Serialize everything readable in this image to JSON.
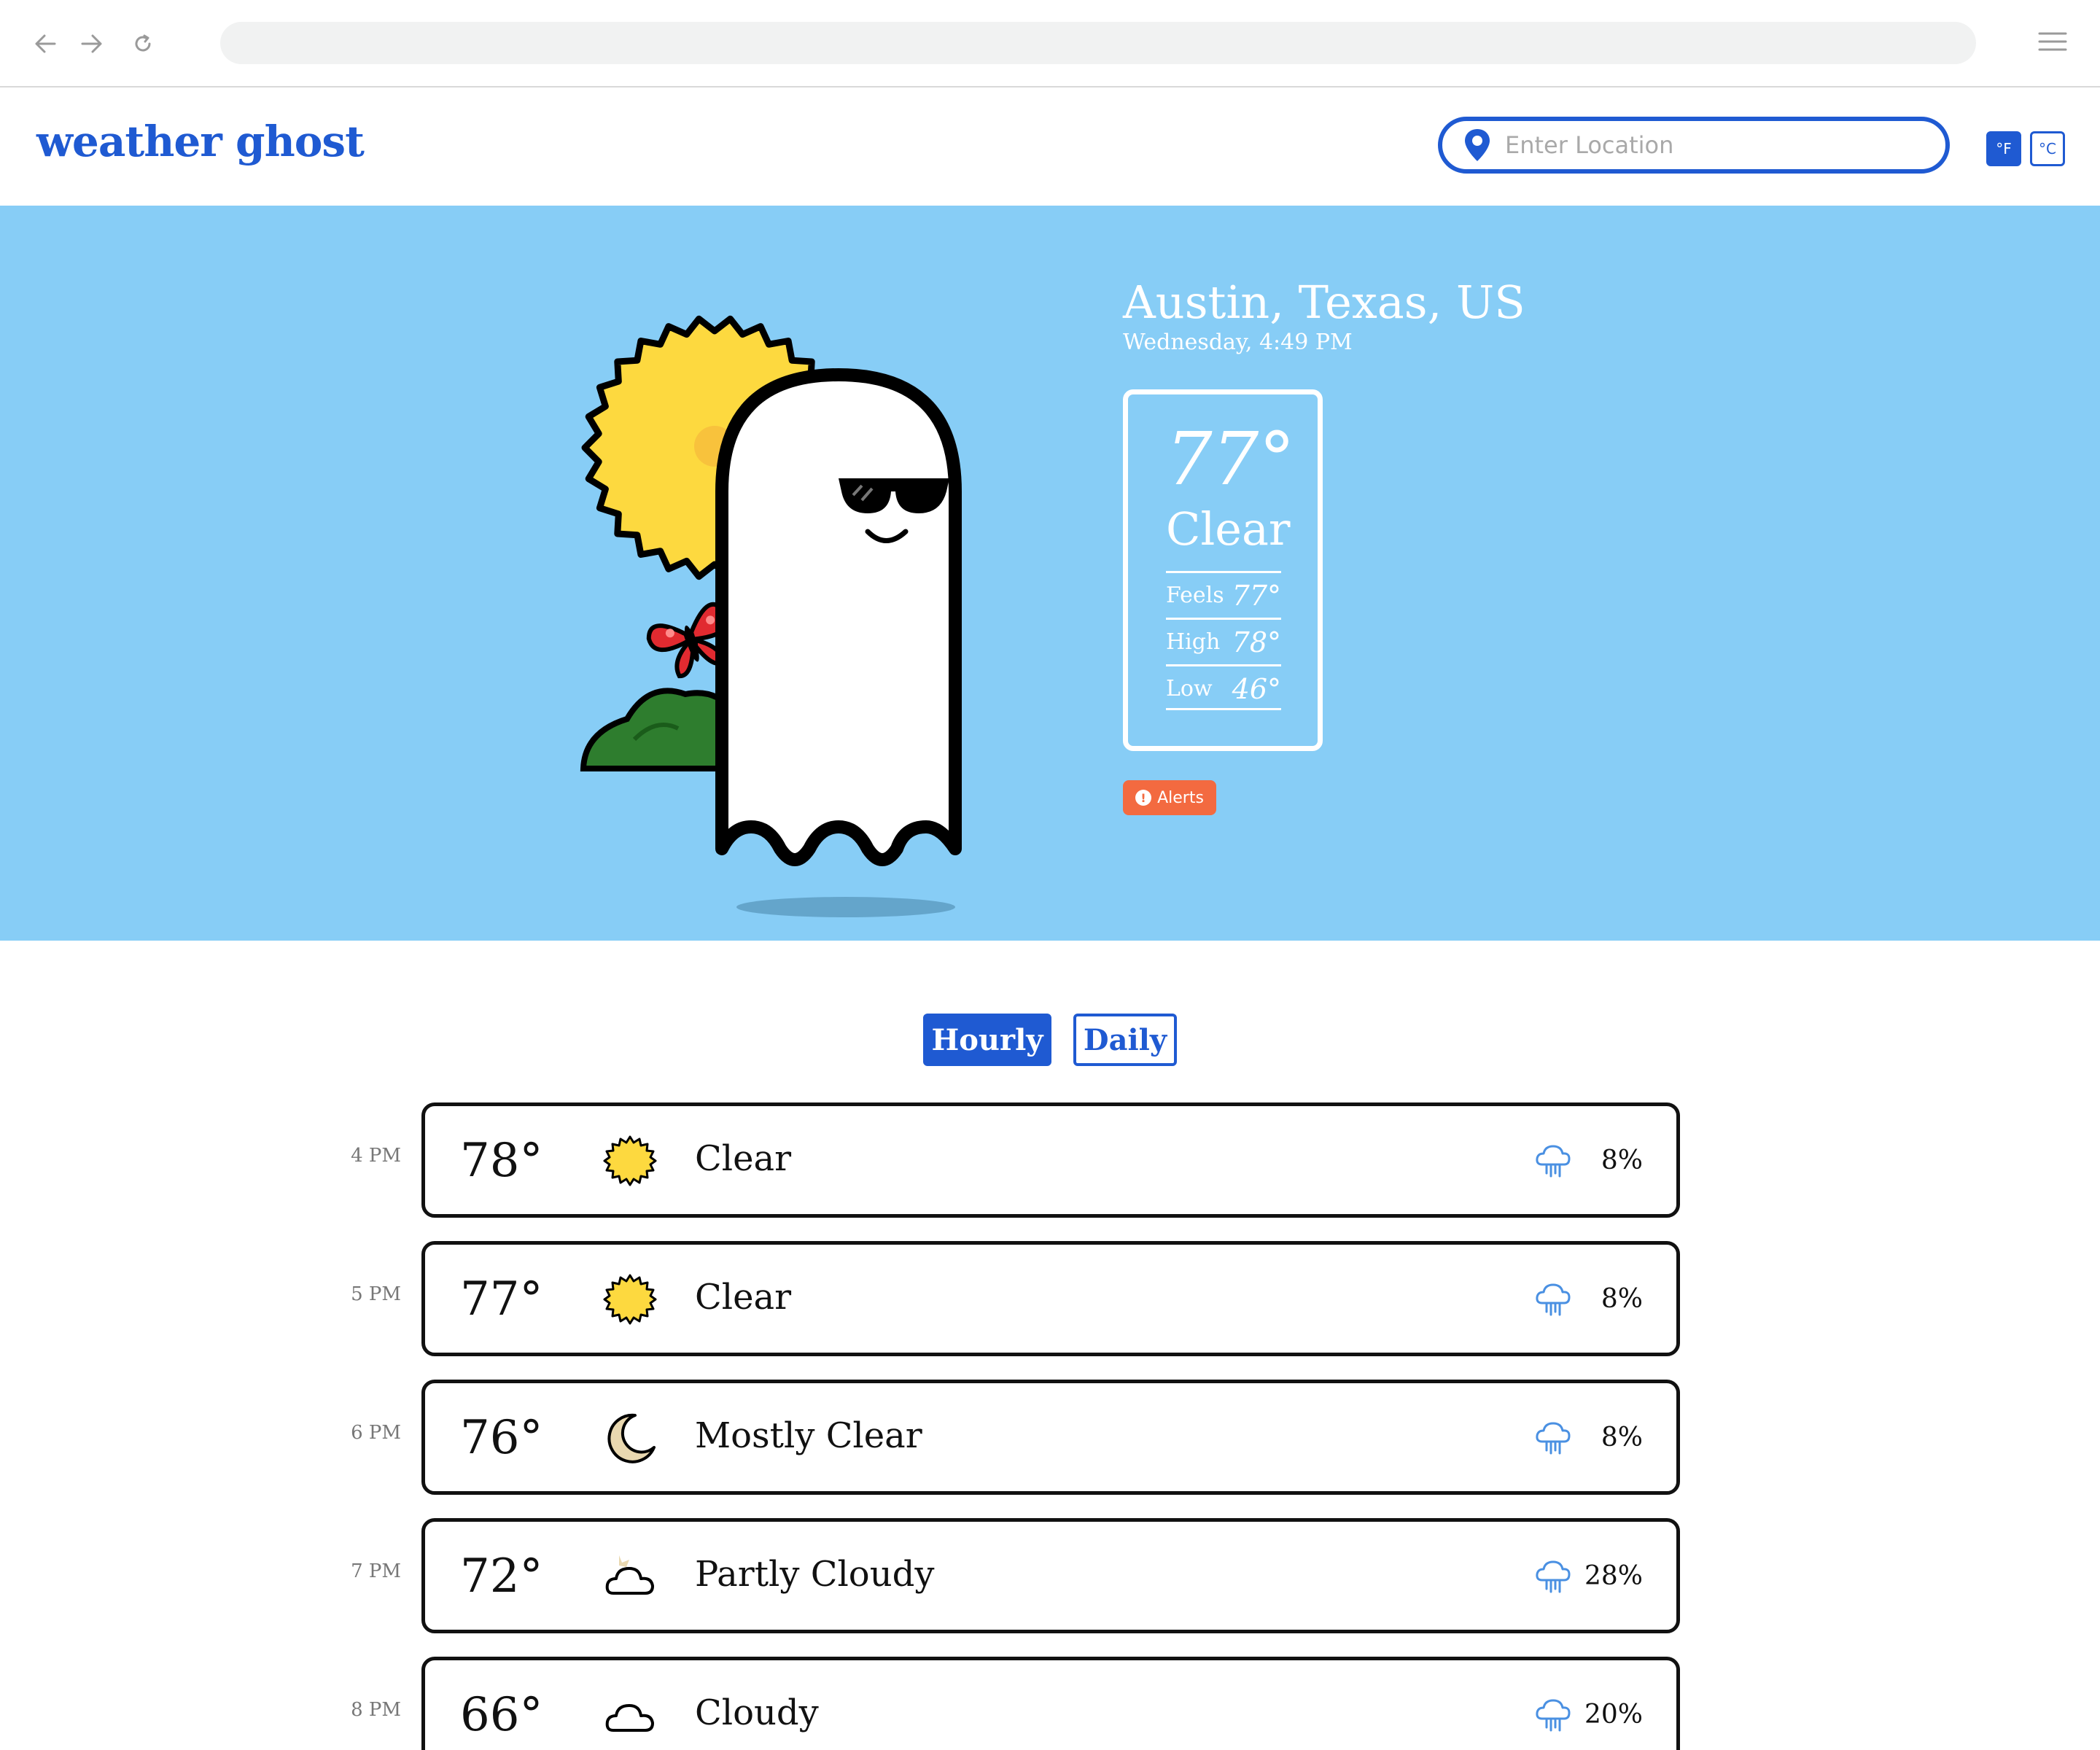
{
  "app": {
    "logo_text": "weather ghost",
    "search_placeholder": "Enter Location",
    "unit_f": "°F",
    "unit_c": "°C",
    "accent_color": "#1f5ad2",
    "hero_color": "#87cdf6",
    "alert_color": "#f36a40"
  },
  "current": {
    "location": "Austin, Texas, US",
    "datetime": "Wednesday, 4:49 PM",
    "temp": "77°",
    "condition": "Clear",
    "feels_label": "Feels",
    "feels_value": "77°",
    "high_label": "High",
    "high_value": "78°",
    "low_label": "Low",
    "low_value": "46°",
    "alerts_label": "Alerts",
    "illustration": "sun-ghost-sunglasses-butterfly"
  },
  "tabs": {
    "hourly": "Hourly",
    "daily": "Daily",
    "active": "Hourly"
  },
  "hourly": [
    {
      "time": "4 PM",
      "temp": "78°",
      "condition": "Clear",
      "icon": "sun-icon",
      "precip": "8%"
    },
    {
      "time": "5 PM",
      "temp": "77°",
      "condition": "Clear",
      "icon": "sun-icon",
      "precip": "8%"
    },
    {
      "time": "6 PM",
      "temp": "76°",
      "condition": "Mostly Clear",
      "icon": "moon-icon",
      "precip": "8%"
    },
    {
      "time": "7 PM",
      "temp": "72°",
      "condition": "Partly Cloudy",
      "icon": "partly-cloudy-icon",
      "precip": "28%"
    },
    {
      "time": "8 PM",
      "temp": "66°",
      "condition": "Cloudy",
      "icon": "cloud-icon",
      "precip": "20%"
    }
  ]
}
